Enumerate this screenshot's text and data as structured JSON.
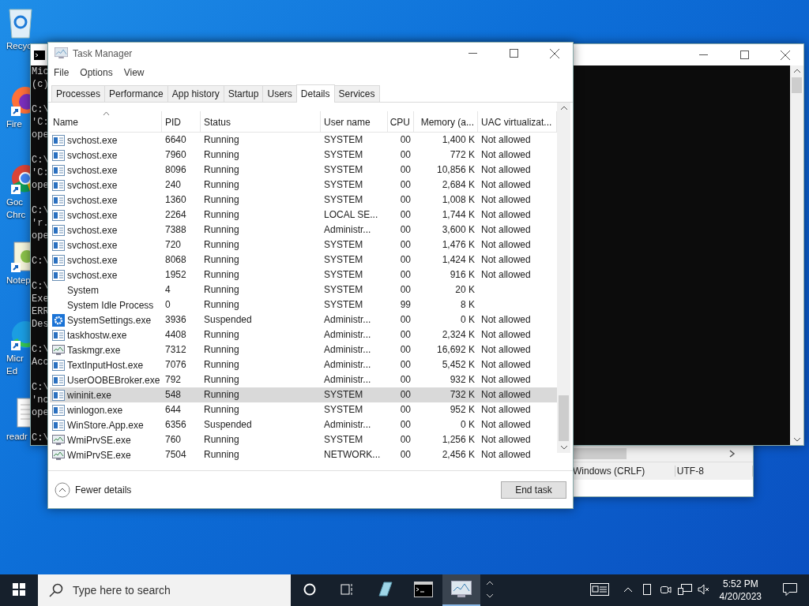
{
  "desktop_icons": [
    {
      "kind": "recycle",
      "lines": [
        "Recyc"
      ]
    },
    {
      "kind": "firefox",
      "lines": [
        "Fire"
      ]
    },
    {
      "kind": "chrome",
      "lines": [
        "Goc",
        "Chrc"
      ]
    },
    {
      "kind": "notepad",
      "lines": [
        "Notep"
      ]
    },
    {
      "kind": "edge",
      "lines": [
        "Micr",
        "Ed"
      ]
    },
    {
      "kind": "file",
      "lines": [
        "readr"
      ]
    }
  ],
  "console": {
    "blocks": [
      [
        "Mic",
        "(c)"
      ],
      [
        "C:\\",
        "'C:",
        "ope"
      ],
      [
        "C:\\",
        "'C:",
        "ope"
      ],
      [
        "C:\\",
        "'r.",
        "ope"
      ],
      [
        "C:\\"
      ],
      [
        "C:\\",
        "Exe",
        "ERR",
        "Des"
      ],
      [
        "C:\\",
        "Acc"
      ],
      [
        "C:\\",
        "'nc",
        "ope"
      ],
      [
        "C:\\"
      ]
    ]
  },
  "notepad": {
    "status": [
      "Windows (CRLF)",
      "UTF-8"
    ]
  },
  "task_manager": {
    "title": "Task Manager",
    "menu": [
      "File",
      "Options",
      "View"
    ],
    "tabs": [
      {
        "label": "Processes",
        "selected": false
      },
      {
        "label": "Performance",
        "selected": false
      },
      {
        "label": "App history",
        "selected": false
      },
      {
        "label": "Startup",
        "selected": false
      },
      {
        "label": "Users",
        "selected": false
      },
      {
        "label": "Details",
        "selected": true
      },
      {
        "label": "Services",
        "selected": false
      }
    ],
    "columns": [
      {
        "label": "Name",
        "sorted": true,
        "numeric": false
      },
      {
        "label": "PID",
        "sorted": false,
        "numeric": false
      },
      {
        "label": "Status",
        "sorted": false,
        "numeric": false
      },
      {
        "label": "User name",
        "sorted": false,
        "numeric": false
      },
      {
        "label": "CPU",
        "sorted": false,
        "numeric": true
      },
      {
        "label": "Memory (a...",
        "sorted": false,
        "numeric": true
      },
      {
        "label": "UAC virtualizat...",
        "sorted": false,
        "numeric": false
      }
    ],
    "rows": [
      {
        "kind": "app",
        "cells": [
          "svchost.exe",
          "6640",
          "Running",
          "SYSTEM",
          "00",
          "1,400 K",
          "Not allowed"
        ],
        "selected": false
      },
      {
        "kind": "app",
        "cells": [
          "svchost.exe",
          "7960",
          "Running",
          "SYSTEM",
          "00",
          "772 K",
          "Not allowed"
        ],
        "selected": false
      },
      {
        "kind": "app",
        "cells": [
          "svchost.exe",
          "8096",
          "Running",
          "SYSTEM",
          "00",
          "10,856 K",
          "Not allowed"
        ],
        "selected": false
      },
      {
        "kind": "app",
        "cells": [
          "svchost.exe",
          "240",
          "Running",
          "SYSTEM",
          "00",
          "2,684 K",
          "Not allowed"
        ],
        "selected": false
      },
      {
        "kind": "app",
        "cells": [
          "svchost.exe",
          "1360",
          "Running",
          "SYSTEM",
          "00",
          "1,008 K",
          "Not allowed"
        ],
        "selected": false
      },
      {
        "kind": "app",
        "cells": [
          "svchost.exe",
          "2264",
          "Running",
          "LOCAL SE...",
          "00",
          "1,744 K",
          "Not allowed"
        ],
        "selected": false
      },
      {
        "kind": "app",
        "cells": [
          "svchost.exe",
          "7388",
          "Running",
          "Administr...",
          "00",
          "3,600 K",
          "Not allowed"
        ],
        "selected": false
      },
      {
        "kind": "app",
        "cells": [
          "svchost.exe",
          "720",
          "Running",
          "SYSTEM",
          "00",
          "1,476 K",
          "Not allowed"
        ],
        "selected": false
      },
      {
        "kind": "app",
        "cells": [
          "svchost.exe",
          "8068",
          "Running",
          "SYSTEM",
          "00",
          "1,424 K",
          "Not allowed"
        ],
        "selected": false
      },
      {
        "kind": "app",
        "cells": [
          "svchost.exe",
          "1952",
          "Running",
          "SYSTEM",
          "00",
          "916 K",
          "Not allowed"
        ],
        "selected": false
      },
      {
        "kind": "none",
        "cells": [
          "System",
          "4",
          "Running",
          "SYSTEM",
          "00",
          "20 K",
          ""
        ],
        "selected": false
      },
      {
        "kind": "none",
        "cells": [
          "System Idle Process",
          "0",
          "Running",
          "SYSTEM",
          "99",
          "8 K",
          ""
        ],
        "selected": false
      },
      {
        "kind": "gear",
        "cells": [
          "SystemSettings.exe",
          "3936",
          "Suspended",
          "Administr...",
          "00",
          "0 K",
          "Not allowed"
        ],
        "selected": false
      },
      {
        "kind": "app",
        "cells": [
          "taskhostw.exe",
          "4408",
          "Running",
          "Administr...",
          "00",
          "2,324 K",
          "Not allowed"
        ],
        "selected": false
      },
      {
        "kind": "monitor",
        "cells": [
          "Taskmgr.exe",
          "7312",
          "Running",
          "Administr...",
          "00",
          "16,692 K",
          "Not allowed"
        ],
        "selected": false
      },
      {
        "kind": "app",
        "cells": [
          "TextInputHost.exe",
          "7076",
          "Running",
          "Administr...",
          "00",
          "5,452 K",
          "Not allowed"
        ],
        "selected": false
      },
      {
        "kind": "app",
        "cells": [
          "UserOOBEBroker.exe",
          "792",
          "Running",
          "Administr...",
          "00",
          "932 K",
          "Not allowed"
        ],
        "selected": false
      },
      {
        "kind": "app",
        "cells": [
          "wininit.exe",
          "548",
          "Running",
          "SYSTEM",
          "00",
          "732 K",
          "Not allowed"
        ],
        "selected": true
      },
      {
        "kind": "app",
        "cells": [
          "winlogon.exe",
          "644",
          "Running",
          "SYSTEM",
          "00",
          "952 K",
          "Not allowed"
        ],
        "selected": false
      },
      {
        "kind": "app",
        "cells": [
          "WinStore.App.exe",
          "6356",
          "Suspended",
          "Administr...",
          "00",
          "0 K",
          "Not allowed"
        ],
        "selected": false
      },
      {
        "kind": "monitor",
        "cells": [
          "WmiPrvSE.exe",
          "760",
          "Running",
          "SYSTEM",
          "00",
          "1,256 K",
          "Not allowed"
        ],
        "selected": false
      },
      {
        "kind": "monitor",
        "cells": [
          "WmiPrvSE.exe",
          "7504",
          "Running",
          "NETWORK...",
          "00",
          "2,456 K",
          "Not allowed"
        ],
        "selected": false
      }
    ],
    "fewer_details": "Fewer details",
    "end_task": "End task"
  },
  "taskbar": {
    "search_placeholder": "Type here to search",
    "apps": [
      {
        "kind": "notepad",
        "active": false
      },
      {
        "kind": "console",
        "active": false
      },
      {
        "kind": "taskmgr",
        "active": true
      }
    ],
    "time": "5:52 PM",
    "date": "4/20/2023"
  }
}
